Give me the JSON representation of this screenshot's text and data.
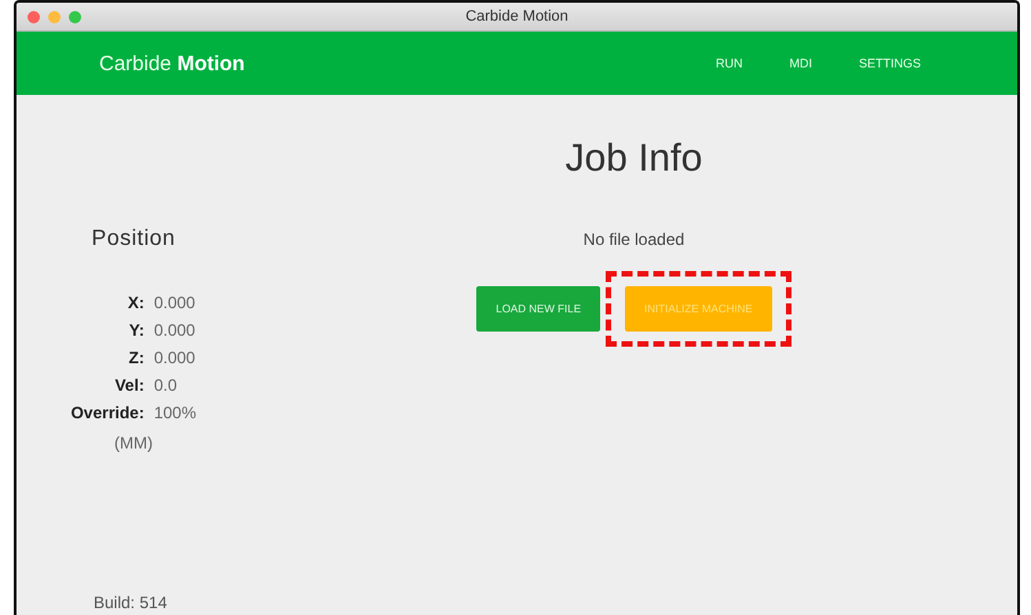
{
  "window": {
    "title": "Carbide Motion"
  },
  "header": {
    "brand": "Carbide",
    "brand_bold": "Motion",
    "nav": [
      {
        "label": "RUN"
      },
      {
        "label": "MDI"
      },
      {
        "label": "SETTINGS"
      }
    ]
  },
  "position": {
    "title": "Position",
    "rows": [
      {
        "label": "X:",
        "value": "0.000"
      },
      {
        "label": "Y:",
        "value": "0.000"
      },
      {
        "label": "Z:",
        "value": "0.000"
      },
      {
        "label": "Vel:",
        "value": "0.0"
      },
      {
        "label": "Override:",
        "value": "100%"
      }
    ],
    "units": "(MM)"
  },
  "build": "Build: 514",
  "job": {
    "title": "Job Info",
    "status": "No file loaded",
    "buttons": [
      {
        "label": "LOAD NEW FILE",
        "kind": "primary",
        "highlighted": false
      },
      {
        "label": "INITIALIZE MACHINE",
        "kind": "warning",
        "highlighted": true
      }
    ]
  }
}
